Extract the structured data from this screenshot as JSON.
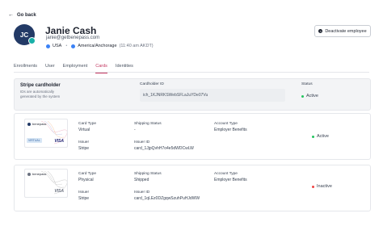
{
  "header": {
    "back_label": "Go back",
    "avatar_initials": "JC",
    "name": "Janie Cash",
    "email": "janie@getbenepass.com",
    "country": "USA",
    "timezone": "America/Anchorage",
    "local_time": "(11:40 am AKDT)",
    "deactivate_label": "Deactivate employee"
  },
  "tabs": [
    "Enrollments",
    "User",
    "Employment",
    "Cards",
    "Identities"
  ],
  "active_tab": "Cards",
  "stripe_cardholder": {
    "title": "Stripe cardholder",
    "subtitle": "IDs are automatically generated by the system",
    "cardholder_id_label": "Cardholder ID",
    "cardholder_id": "ich_1KJNRKSWebSFLaJuYDe07Vu",
    "status_label": "Status",
    "status": "Active",
    "status_color": "#22c55e"
  },
  "cards": [
    {
      "brand": "benepass",
      "tag": "VIRTUAL",
      "network": "VISA",
      "card_type_label": "Card Type",
      "card_type": "Virtual",
      "issuer_label": "Issuer",
      "issuer": "Stripe",
      "shipping_status_label": "Shipping Status",
      "shipping_status": "-",
      "issuer_id_label": "Issuer ID",
      "issuer_id": "card_1JjpQvhH7o4e5dWDCwLW",
      "account_type_label": "Account Type",
      "account_type": "Employer Benefits",
      "status": "Active",
      "status_color": "#22c55e"
    },
    {
      "brand": "benepass",
      "tag": "",
      "network": "VISA",
      "card_type_label": "Card Type",
      "card_type": "Physical",
      "issuer_label": "Issuer",
      "issuer": "Stripe",
      "shipping_status_label": "Shipping Status",
      "shipping_status": "Shipped",
      "issuer_id_label": "Issuer ID",
      "issuer_id": "card_1qLEz0DZgqwSzuhPuHJdWW",
      "account_type_label": "Account Type",
      "account_type": "Employer Benefits",
      "status": "Inactive",
      "status_color": "#ef4444"
    }
  ]
}
